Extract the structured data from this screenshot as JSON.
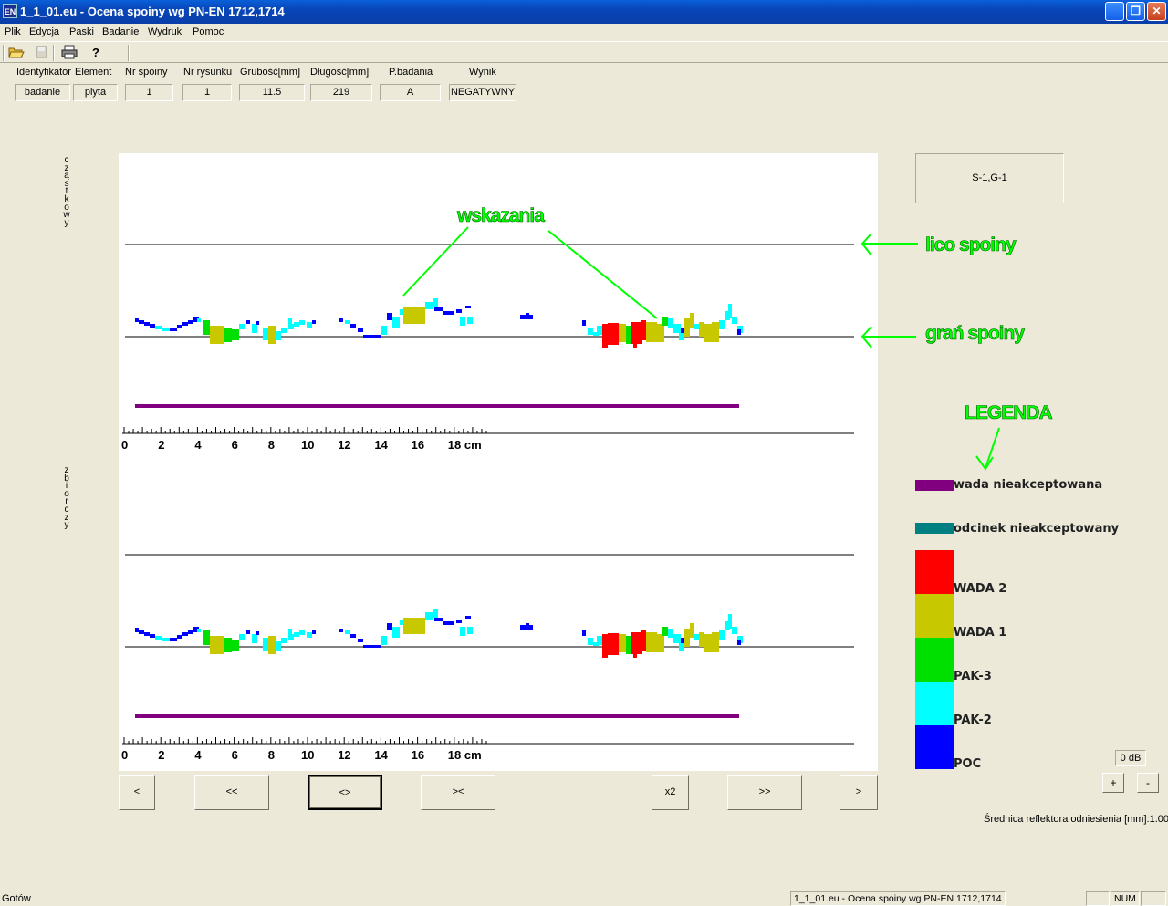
{
  "window": {
    "title": "1_1_01.eu - Ocena spoiny wg PN-EN 1712,1714",
    "icon_text": "EN"
  },
  "menu": [
    "Plik",
    "Edycja",
    "Paski",
    "Badanie",
    "Wydruk",
    "Pomoc"
  ],
  "toolbar": {
    "icons": [
      "open-folder-icon",
      "save-icon",
      "print-icon",
      "help-icon"
    ]
  },
  "header": {
    "labels": [
      "Identyfikator",
      "Element",
      "Nr spoiny",
      "Nr rysunku",
      "Grubość[mm]",
      "Długość[mm]",
      "P.badania",
      "Wynik"
    ],
    "values": [
      "badanie",
      "plyta",
      "1",
      "1",
      "11.5",
      "219",
      "A",
      "NEGATYWNY"
    ]
  },
  "vertical_labels": {
    "top": "cząstkowy",
    "bottom": "zbiorczy"
  },
  "annotations": {
    "wskazania": "wskazania",
    "lico": "lico spoiny",
    "gran": "grań spoiny",
    "legenda": "LEGENDA"
  },
  "side_box": "S-1,G-1",
  "legend": {
    "wada_nieakceptowana": "wada nieakceptowana",
    "odcinek_nieakceptowany": "odcinek nieakceptowany",
    "wada2": "WADA 2",
    "wada1": "WADA 1",
    "pak3": "PAK-3",
    "pak2": "PAK-2",
    "poc": "POC"
  },
  "colors": {
    "wada_nieakceptowana": "#800080",
    "odcinek_nieakceptowany": "#008080",
    "wada2": "#ff0000",
    "wada1": "#c8c800",
    "pak3": "#00e000",
    "pak2": "#00ffff",
    "poc": "#0000ff",
    "annotation": "#00ff00"
  },
  "nav_buttons": [
    "<",
    "<<",
    "<>",
    "><",
    "x2",
    ">>",
    ">"
  ],
  "gain": "0 dB",
  "gain_buttons": [
    "+",
    "-"
  ],
  "reference_text": "Średnica reflektora odniesienia [mm]:1.00",
  "axis": {
    "ticks": [
      "0",
      "2",
      "4",
      "6",
      "8",
      "10",
      "12",
      "14",
      "16",
      "18 cm"
    ]
  },
  "status": {
    "left": "Gotów",
    "doc": "1_1_01.eu - Ocena spoiny wg PN-EN 1712,1714",
    "num": "NUM"
  }
}
